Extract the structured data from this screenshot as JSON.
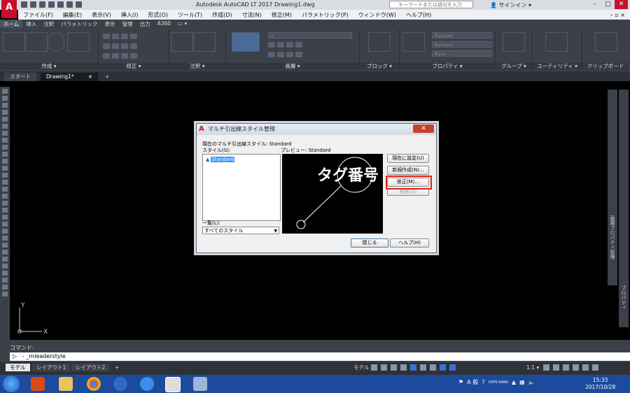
{
  "app": {
    "title": "Autodesk AutoCAD LT 2017    Drawing1.dwg",
    "logo_label": "A",
    "logo_sub": "LT",
    "search_placeholder": "キーワードまたは語句を入力",
    "signin_label": "サインイン"
  },
  "window_controls": {
    "minimize": "–",
    "maximize": "□",
    "close": "✕"
  },
  "menubar": {
    "items": [
      "ファイル(F)",
      "編集(E)",
      "表示(V)",
      "挿入(I)",
      "形式(O)",
      "ツール(T)",
      "作成(D)",
      "寸法(N)",
      "修正(M)",
      "パラメトリック(P)",
      "ウィンドウ(W)",
      "ヘルプ(H)"
    ],
    "mdi_controls": "– ▫ ×"
  },
  "ribbon_tabs": [
    "ホーム",
    "挿入",
    "注釈",
    "パラメトリック",
    "表示",
    "管理",
    "出力",
    "A360",
    "▭ ▾"
  ],
  "ribbon_panels": {
    "draw": "作成 ▾",
    "modify": "修正 ▾",
    "annotation": "注釈 ▾",
    "layers": "画層 ▾",
    "block": "ブロック ▾",
    "properties": "プロパティ ▾",
    "groups": "グループ ▾",
    "utilities": "ユーティリティ ▾",
    "clipboard": "クリップボード"
  },
  "ribbon_dropdowns": {
    "layer": "0",
    "bylayer1": "ByLayer",
    "bylayer2": "ByLayer",
    "bylayer3": "ByLa..."
  },
  "doc_tabs": [
    {
      "label": "スタート"
    },
    {
      "label": "Drawing1*",
      "close": "×"
    }
  ],
  "doc_tab_plus": "+",
  "right_palettes": {
    "p1": "画層プロパティ管理",
    "p2": "プロパティ"
  },
  "ucs": {
    "x": "X",
    "y": "Y"
  },
  "command": {
    "label": "コマンド:",
    "prompt_icon": "▷",
    "input": "- _mleaderstyle"
  },
  "layout_tabs": [
    "モデル",
    "レイアウト1",
    "レイアウト2"
  ],
  "layout_plus": "+",
  "status": {
    "model": "モデル",
    "scale": "1:1 ▾"
  },
  "dialog": {
    "title": "マルチ引出線スタイル管理",
    "close": "✕",
    "current_style": "現在のマルチ引出線スタイル: Standard",
    "styles_label": "スタイル(S):",
    "styles": [
      "Standard"
    ],
    "list_label": "一覧(L):",
    "list_value": "すべてのスタイル",
    "preview_label": "プレビュー: Standard",
    "preview_text": "タグ番号",
    "buttons": {
      "set_current": "現在に設定(U)",
      "new": "新規作成(N)...",
      "modify": "修正(M)...",
      "delete": "削除(D)",
      "close": "閉じる",
      "help": "ヘルプ(H)"
    }
  },
  "taskbar": {
    "ime": "A 般",
    "caps": "CAPS KANA",
    "time": "15:33",
    "date": "2017/10/28"
  },
  "colors": {
    "accent": "#c8102e",
    "highlight_box": "#e0201c",
    "selection": "#3399ff",
    "taskbar": "#1c4a9c"
  }
}
